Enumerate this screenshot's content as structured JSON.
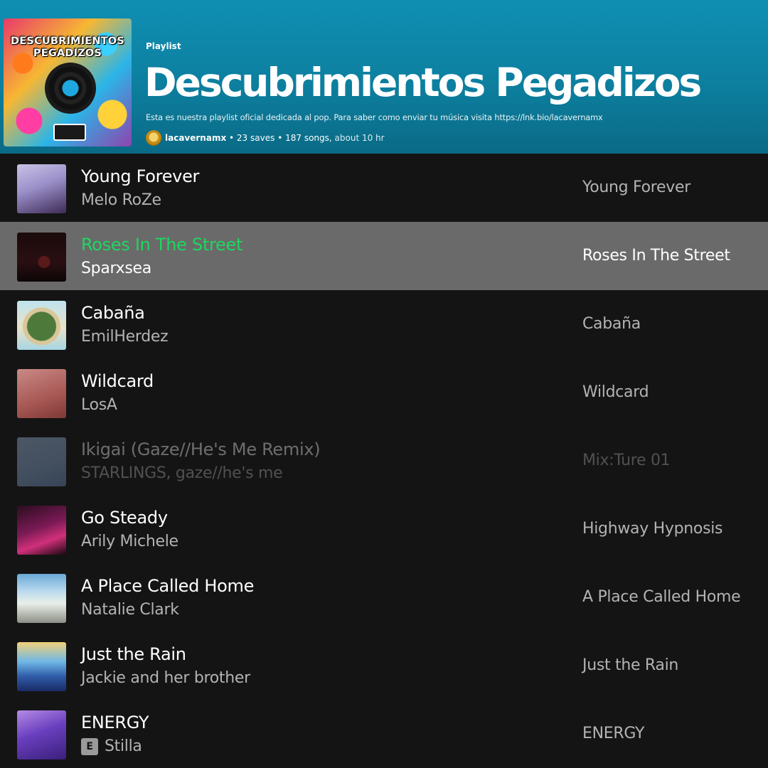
{
  "header": {
    "cover_text": "DESCUBRIMIENTOS PEGADIZOS",
    "type_label": "Playlist",
    "title": "Descubrimientos Pegadizos",
    "description": "Esta es nuestra playlist oficial dedicada al pop. Para saber como enviar tu música visita https://lnk.bio/lacavernamx",
    "owner": "lacavernamx",
    "saves": "23 saves",
    "songs": "187 songs,",
    "duration": "about 10 hr",
    "separator": "•"
  },
  "colors": {
    "header_bg": "#0d7f9f",
    "list_bg": "#141414",
    "active_row_bg": "#6a6a6a",
    "playing_green": "#1ed760"
  },
  "tracks": [
    {
      "title": "Young Forever",
      "artist": "Melo RoZe",
      "album": "Young Forever",
      "explicit": false,
      "state": "normal"
    },
    {
      "title": "Roses In The Street",
      "artist": "Sparxsea",
      "album": "Roses In The Street",
      "explicit": false,
      "state": "playing"
    },
    {
      "title": "Cabaña",
      "artist": "EmilHerdez",
      "album": "Cabaña",
      "explicit": false,
      "state": "normal"
    },
    {
      "title": "Wildcard",
      "artist": "LosA",
      "album": "Wildcard",
      "explicit": false,
      "state": "normal"
    },
    {
      "title": "Ikigai (Gaze//He's Me Remix)",
      "artist": "STARLINGS, gaze//he's me",
      "album": "Mix:Ture 01",
      "explicit": false,
      "state": "unavailable"
    },
    {
      "title": "Go Steady",
      "artist": "Arily Michele",
      "album": "Highway Hypnosis",
      "explicit": false,
      "state": "normal"
    },
    {
      "title": "A Place Called Home",
      "artist": "Natalie Clark",
      "album": "A Place Called Home",
      "explicit": false,
      "state": "normal"
    },
    {
      "title": "Just the Rain",
      "artist": "Jackie and her brother",
      "album": "Just the Rain",
      "explicit": false,
      "state": "normal"
    },
    {
      "title": "ENERGY",
      "artist": "Stilla",
      "album": "ENERGY",
      "explicit": true,
      "explicit_label": "E",
      "state": "normal"
    }
  ]
}
